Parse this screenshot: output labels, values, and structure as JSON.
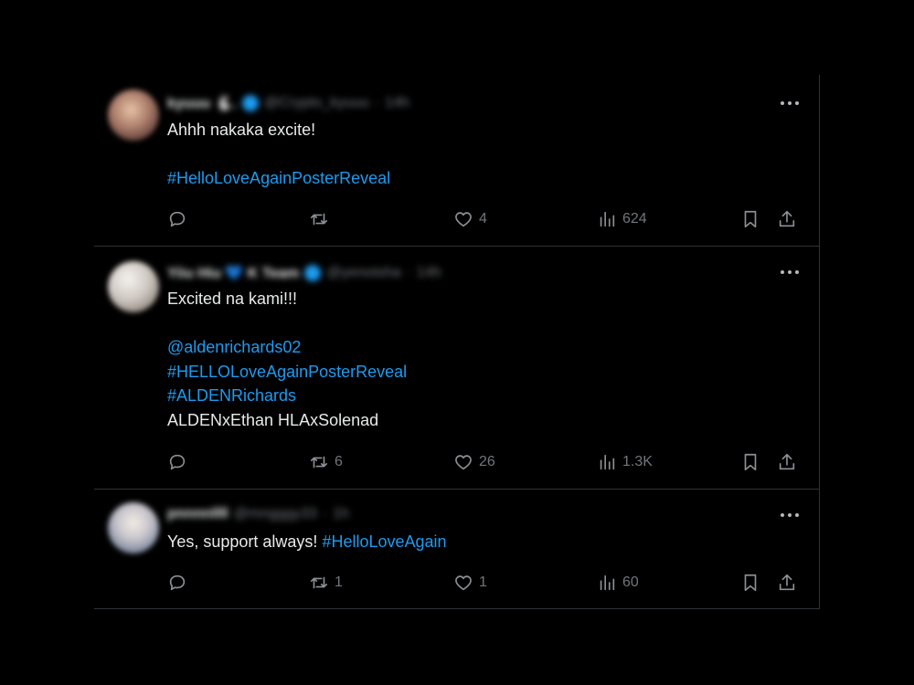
{
  "tweets": [
    {
      "author_name": "kyuuu 🐇.",
      "author_handle": "@Crypto_kyuuu",
      "time": "14h",
      "lines": [
        {
          "text": "Ahhh nakaka excite!",
          "type": "text"
        },
        {
          "text": "",
          "type": "gap"
        },
        {
          "text": "#HelloLoveAgainPosterReveal",
          "type": "link"
        }
      ],
      "replies": "",
      "retweets": "",
      "likes": "4",
      "views": "624"
    },
    {
      "author_name": "Yiiu Hiu 💙 K Team",
      "author_handle": "@yenotsha",
      "time": "14h",
      "lines": [
        {
          "text": "Excited na kami!!!",
          "type": "text"
        },
        {
          "text": "",
          "type": "gap"
        },
        {
          "text": "@aldenrichards02",
          "type": "link"
        },
        {
          "text": "#HELLOLoveAgainPosterReveal",
          "type": "link"
        },
        {
          "text": "#ALDENRichards",
          "type": "link"
        },
        {
          "text": "ALDENxEthan HLAxSolenad",
          "type": "text"
        }
      ],
      "replies": "",
      "retweets": "6",
      "likes": "26",
      "views": "1.3K"
    },
    {
      "author_name": "pnnnnllll",
      "author_handle": "@mngggy33",
      "time": "1h",
      "lines": [
        {
          "text": "Yes, support always! ",
          "type": "text",
          "trail_link": "#HelloLoveAgain"
        }
      ],
      "replies": "",
      "retweets": "1",
      "likes": "1",
      "views": "60"
    }
  ],
  "icons": {
    "reply": "reply-icon",
    "retweet": "retweet-icon",
    "like": "heart-icon",
    "views": "views-chart-icon",
    "bookmark": "bookmark-icon",
    "share": "share-icon",
    "more": "more-dots-icon"
  },
  "colors": {
    "background": "#000000",
    "text": "#e7e9ea",
    "muted": "#71767b",
    "link": "#1d9bf0",
    "border": "#2f3336"
  }
}
